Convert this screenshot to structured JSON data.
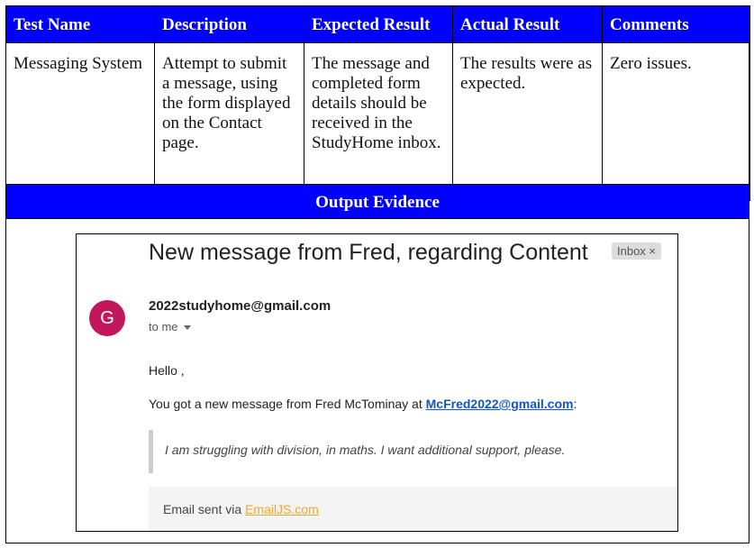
{
  "table": {
    "headers": [
      "Test Name",
      "Description",
      "Expected Result",
      "Actual Result",
      "Comments"
    ],
    "row": {
      "test_name": "Messaging System",
      "description": "Attempt to submit a message, using the form displayed on the Contact page.",
      "expected": "The message and completed form details should be received in the StudyHome inbox.",
      "actual": "The results were as expected.",
      "comments": "Zero issues."
    }
  },
  "evidence": {
    "heading": "Output Evidence"
  },
  "email": {
    "subject": "New message from Fred, regarding Content",
    "label_chip": "Inbox ×",
    "avatar_letter": "G",
    "sender": "2022studyhome@gmail.com",
    "to_me": "to me",
    "greeting": "Hello ,",
    "line_prefix": "You got a new message from Fred McTominay at ",
    "line_email": "McFred2022@gmail.com",
    "line_suffix": ":",
    "quote": "I am struggling with division, in maths. I want additional support, please.",
    "footer_prefix": "Email sent via ",
    "footer_link": "EmailJS.com",
    "colors": {
      "avatar": "#c2185b",
      "link": "#1155cc",
      "footer_link": "#f5a623",
      "header_blue": "#0000ff"
    }
  }
}
